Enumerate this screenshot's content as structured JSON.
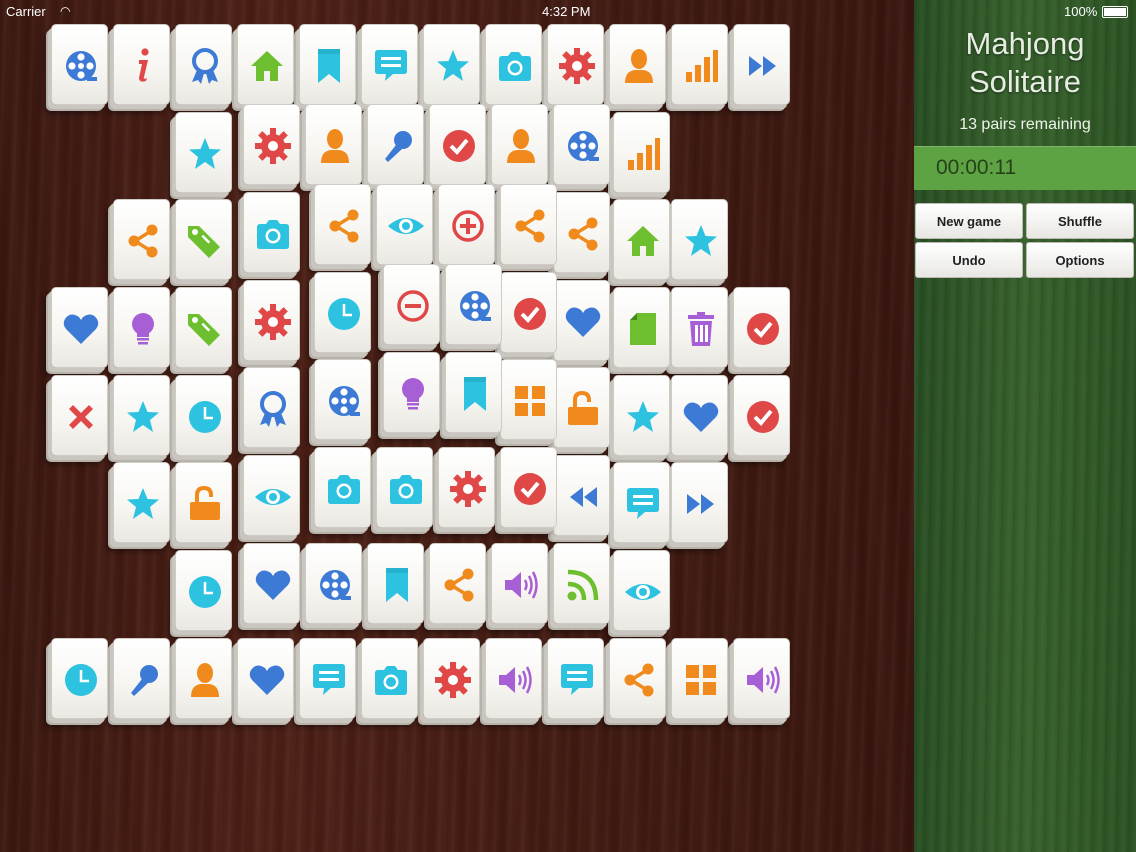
{
  "status_bar": {
    "carrier": "Carrier",
    "time": "4:32 PM",
    "battery": "100%"
  },
  "panel": {
    "title_line1": "Mahjong",
    "title_line2": "Solitaire",
    "pairs_remaining": "13 pairs remaining",
    "timer": "00:00:11",
    "buttons": {
      "new_game": "New game",
      "shuffle": "Shuffle",
      "undo": "Undo",
      "options": "Options"
    }
  },
  "colors": {
    "accent_green": "#5ea343",
    "tile_face": "#f7f6f2"
  },
  "tiles": [
    {
      "icon": "film-reel-icon",
      "color": "#3d7ad6"
    },
    {
      "icon": "info-icon",
      "color": "#e04848"
    },
    {
      "icon": "ribbon-badge-icon",
      "color": "#3d7ad6"
    },
    {
      "icon": "home-icon",
      "color": "#6dbf2f"
    },
    {
      "icon": "bookmark-icon",
      "color": "#2cc2e0"
    },
    {
      "icon": "chat-bubble-icon",
      "color": "#2cc2e0"
    },
    {
      "icon": "star-icon",
      "color": "#2cc2e0"
    },
    {
      "icon": "camera-icon",
      "color": "#2cc2e0"
    },
    {
      "icon": "gear-icon",
      "color": "#e04848"
    },
    {
      "icon": "person-icon",
      "color": "#f08a1c"
    },
    {
      "icon": "signal-bars-icon",
      "color": "#f08a1c"
    },
    {
      "icon": "fast-forward-icon",
      "color": "#3d7ad6"
    },
    {
      "icon": "star-icon",
      "color": "#2cc2e0"
    },
    {
      "icon": "gear-icon",
      "color": "#e04848"
    },
    {
      "icon": "person-icon",
      "color": "#f08a1c"
    },
    {
      "icon": "microphone-icon",
      "color": "#3d7ad6"
    },
    {
      "icon": "check-circle-icon",
      "color": "#e04848"
    },
    {
      "icon": "person-icon",
      "color": "#f08a1c"
    },
    {
      "icon": "film-reel-icon",
      "color": "#3d7ad6"
    },
    {
      "icon": "signal-bars-icon",
      "color": "#f08a1c"
    },
    {
      "icon": "share-icon",
      "color": "#f08a1c"
    },
    {
      "icon": "tag-icon",
      "color": "#6dbf2f"
    },
    {
      "icon": "camera-icon",
      "color": "#2cc2e0"
    },
    {
      "icon": "share-icon",
      "color": "#f08a1c"
    },
    {
      "icon": "eye-icon",
      "color": "#2cc2e0"
    },
    {
      "icon": "plus-circle-icon",
      "color": "#e04848"
    },
    {
      "icon": "share-icon",
      "color": "#f08a1c"
    },
    {
      "icon": "share-icon",
      "color": "#f08a1c"
    },
    {
      "icon": "home-icon",
      "color": "#6dbf2f"
    },
    {
      "icon": "star-icon",
      "color": "#2cc2e0"
    },
    {
      "icon": "heart-icon",
      "color": "#3d7ad6"
    },
    {
      "icon": "lightbulb-icon",
      "color": "#a75fd6"
    },
    {
      "icon": "tag-icon",
      "color": "#6dbf2f"
    },
    {
      "icon": "gear-icon",
      "color": "#e04848"
    },
    {
      "icon": "clock-icon",
      "color": "#2cc2e0"
    },
    {
      "icon": "minus-circle-icon",
      "color": "#e04848"
    },
    {
      "icon": "film-reel-icon",
      "color": "#3d7ad6"
    },
    {
      "icon": "check-circle-icon",
      "color": "#e04848"
    },
    {
      "icon": "heart-icon",
      "color": "#3d7ad6"
    },
    {
      "icon": "document-icon",
      "color": "#6dbf2f"
    },
    {
      "icon": "trash-icon",
      "color": "#a75fd6"
    },
    {
      "icon": "check-circle-icon",
      "color": "#e04848"
    },
    {
      "icon": "close-x-icon",
      "color": "#e04848"
    },
    {
      "icon": "star-icon",
      "color": "#2cc2e0"
    },
    {
      "icon": "clock-icon",
      "color": "#2cc2e0"
    },
    {
      "icon": "ribbon-badge-icon",
      "color": "#3d7ad6"
    },
    {
      "icon": "film-reel-icon",
      "color": "#3d7ad6"
    },
    {
      "icon": "lightbulb-icon",
      "color": "#a75fd6"
    },
    {
      "icon": "bookmark-icon",
      "color": "#2cc2e0"
    },
    {
      "icon": "grid-icon",
      "color": "#f08a1c"
    },
    {
      "icon": "unlock-icon",
      "color": "#f08a1c"
    },
    {
      "icon": "star-icon",
      "color": "#2cc2e0"
    },
    {
      "icon": "heart-icon",
      "color": "#3d7ad6"
    },
    {
      "icon": "check-circle-icon",
      "color": "#e04848"
    },
    {
      "icon": "star-icon",
      "color": "#2cc2e0"
    },
    {
      "icon": "unlock-icon",
      "color": "#f08a1c"
    },
    {
      "icon": "eye-icon",
      "color": "#2cc2e0"
    },
    {
      "icon": "camera-icon",
      "color": "#2cc2e0"
    },
    {
      "icon": "camera-icon",
      "color": "#2cc2e0"
    },
    {
      "icon": "gear-icon",
      "color": "#e04848"
    },
    {
      "icon": "check-circle-icon",
      "color": "#e04848"
    },
    {
      "icon": "rewind-icon",
      "color": "#3d7ad6"
    },
    {
      "icon": "chat-bubble-icon",
      "color": "#2cc2e0"
    },
    {
      "icon": "fast-forward-icon",
      "color": "#3d7ad6"
    },
    {
      "icon": "clock-icon",
      "color": "#2cc2e0"
    },
    {
      "icon": "heart-icon",
      "color": "#3d7ad6"
    },
    {
      "icon": "film-reel-icon",
      "color": "#3d7ad6"
    },
    {
      "icon": "bookmark-icon",
      "color": "#2cc2e0"
    },
    {
      "icon": "share-icon",
      "color": "#f08a1c"
    },
    {
      "icon": "speaker-icon",
      "color": "#a75fd6"
    },
    {
      "icon": "rss-icon",
      "color": "#6dbf2f"
    },
    {
      "icon": "eye-icon",
      "color": "#2cc2e0"
    },
    {
      "icon": "clock-icon",
      "color": "#2cc2e0"
    },
    {
      "icon": "microphone-icon",
      "color": "#3d7ad6"
    },
    {
      "icon": "person-icon",
      "color": "#f08a1c"
    },
    {
      "icon": "heart-icon",
      "color": "#3d7ad6"
    },
    {
      "icon": "chat-bubble-icon",
      "color": "#2cc2e0"
    },
    {
      "icon": "camera-icon",
      "color": "#2cc2e0"
    },
    {
      "icon": "gear-icon",
      "color": "#e04848"
    },
    {
      "icon": "speaker-icon",
      "color": "#a75fd6"
    },
    {
      "icon": "chat-bubble-icon",
      "color": "#2cc2e0"
    },
    {
      "icon": "share-icon",
      "color": "#f08a1c"
    },
    {
      "icon": "grid-icon",
      "color": "#f08a1c"
    },
    {
      "icon": "speaker-icon",
      "color": "#a75fd6"
    }
  ]
}
